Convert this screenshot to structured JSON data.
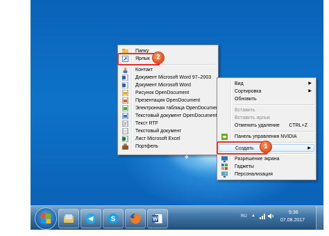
{
  "desktop_menu": {
    "items": [
      {
        "label": "Вид",
        "arrow": "▶",
        "disabled": false
      },
      {
        "label": "Сортировка",
        "arrow": "▶",
        "disabled": false
      },
      {
        "label": "Обновить",
        "disabled": false
      },
      {
        "label": "Вставить",
        "disabled": true
      },
      {
        "label": "Вставить ярлык",
        "disabled": true
      },
      {
        "label": "Отменить удаление",
        "shortcut": "CTRL+Z",
        "disabled": false
      },
      {
        "label": "Панель управления NVIDIA",
        "icon": "nvidia-icon",
        "disabled": false
      },
      {
        "label": "Создать",
        "arrow": "▶",
        "disabled": false
      },
      {
        "label": "Разрешение экрана",
        "icon": "screen-resolution-icon",
        "disabled": false
      },
      {
        "label": "Гаджеты",
        "icon": "gadgets-icon",
        "disabled": false
      },
      {
        "label": "Персонализация",
        "icon": "personalization-icon",
        "disabled": false
      }
    ]
  },
  "create_submenu": {
    "items": [
      {
        "label": "Папку",
        "icon": "folder-icon"
      },
      {
        "label": "Ярлык",
        "icon": "shortcut-icon"
      },
      {
        "label": "Контакт",
        "icon": "contact-icon"
      },
      {
        "label": "Документ Microsoft Word 97–2003",
        "icon": "word-document-icon"
      },
      {
        "label": "Документ Microsoft Word",
        "icon": "word-document-icon"
      },
      {
        "label": "Рисунок OpenDocument",
        "icon": "odg-icon"
      },
      {
        "label": "Презентация OpenDocument",
        "icon": "odp-icon"
      },
      {
        "label": "Электронная таблица OpenDocument",
        "icon": "ods-icon"
      },
      {
        "label": "Текстовый документ OpenDocument",
        "icon": "odt-icon"
      },
      {
        "label": "Текст RTF",
        "icon": "rtf-icon"
      },
      {
        "label": "Текстовый документ",
        "icon": "text-document-icon"
      },
      {
        "label": "Лист Microsoft Excel",
        "icon": "excel-sheet-icon"
      },
      {
        "label": "Портфель",
        "icon": "briefcase-icon"
      }
    ]
  },
  "callouts": {
    "step1": "1",
    "step2": "2"
  },
  "taskbar": {
    "pinned": [
      "explorer-icon",
      "telegram-icon",
      "skype-icon",
      "firefox-icon",
      "word-icon"
    ],
    "language": "RU",
    "time": "9:36",
    "date": "07.08.2017"
  },
  "colors": {
    "highlight_border": "#e5302a",
    "badge": "#e2501f",
    "accent": "#1a6fc6"
  }
}
